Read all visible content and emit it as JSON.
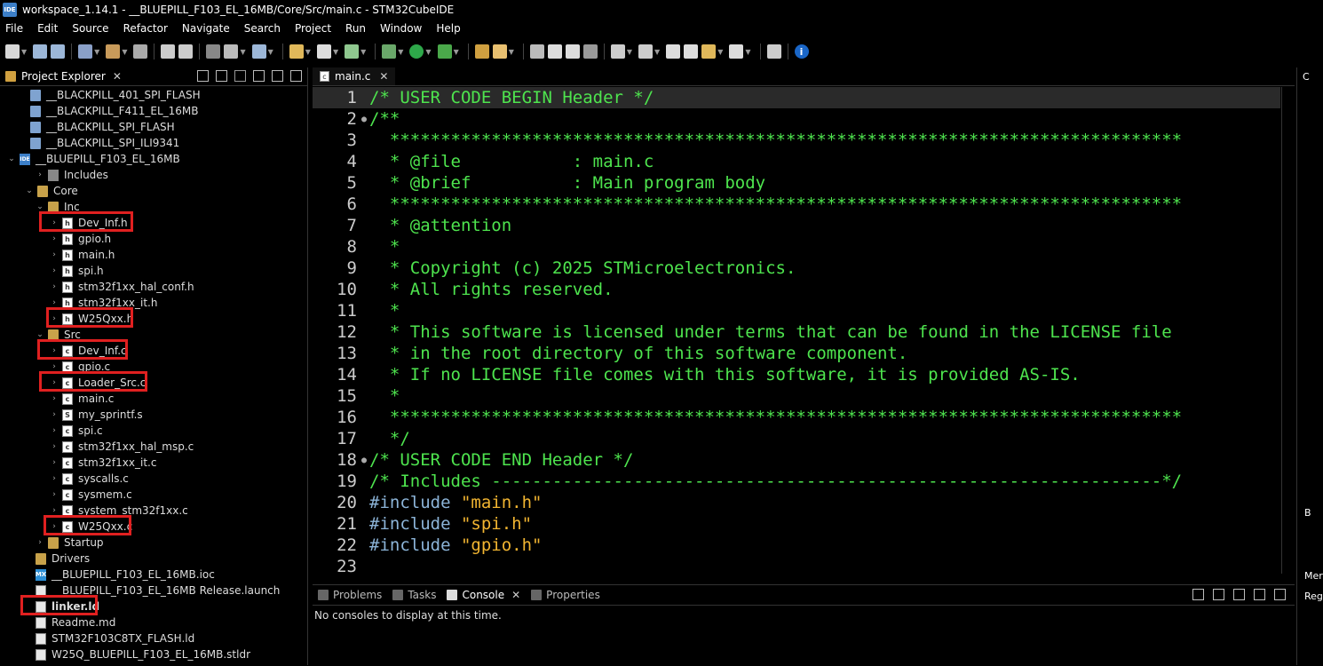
{
  "window": {
    "title": "workspace_1.14.1 - __BLUEPILL_F103_EL_16MB/Core/Src/main.c - STM32CubeIDE",
    "app_icon": "IDE"
  },
  "menu": [
    "File",
    "Edit",
    "Source",
    "Refactor",
    "Navigate",
    "Search",
    "Project",
    "Run",
    "Window",
    "Help"
  ],
  "explorer": {
    "tab_label": "Project Explorer",
    "items": [
      {
        "label": "__BLACKPILL_401_SPI_FLASH",
        "icon": "project-folder-icon"
      },
      {
        "label": "__BLACKPILL_F411_EL_16MB",
        "icon": "project-folder-icon"
      },
      {
        "label": "__BLACKPILL_SPI_FLASH",
        "icon": "project-folder-icon"
      },
      {
        "label": "__BLACKPILL_SPI_ILI9341",
        "icon": "project-folder-icon"
      },
      {
        "label": "__BLUEPILL_F103_EL_16MB",
        "icon": "ide-project-icon"
      },
      {
        "label": "Includes",
        "icon": "includes-icon"
      },
      {
        "label": "Core",
        "icon": "folder-icon"
      },
      {
        "label": "Inc",
        "icon": "folder-icon"
      },
      {
        "label": "Dev_Inf.h",
        "icon": "h-file-icon"
      },
      {
        "label": "gpio.h",
        "icon": "h-file-icon"
      },
      {
        "label": "main.h",
        "icon": "h-file-icon"
      },
      {
        "label": "spi.h",
        "icon": "h-file-icon"
      },
      {
        "label": "stm32f1xx_hal_conf.h",
        "icon": "h-file-icon"
      },
      {
        "label": "stm32f1xx_it.h",
        "icon": "h-file-icon"
      },
      {
        "label": "W25Qxx.h",
        "icon": "h-file-icon"
      },
      {
        "label": "Src",
        "icon": "folder-icon"
      },
      {
        "label": "Dev_Inf.c",
        "icon": "c-file-icon"
      },
      {
        "label": "gpio.c",
        "icon": "c-file-icon"
      },
      {
        "label": "Loader_Src.c",
        "icon": "c-file-icon"
      },
      {
        "label": "main.c",
        "icon": "c-file-icon"
      },
      {
        "label": "my_sprintf.s",
        "icon": "s-file-icon"
      },
      {
        "label": "spi.c",
        "icon": "c-file-icon"
      },
      {
        "label": "stm32f1xx_hal_msp.c",
        "icon": "c-file-icon"
      },
      {
        "label": "stm32f1xx_it.c",
        "icon": "c-file-icon"
      },
      {
        "label": "syscalls.c",
        "icon": "c-file-icon"
      },
      {
        "label": "sysmem.c",
        "icon": "c-file-icon"
      },
      {
        "label": "system_stm32f1xx.c",
        "icon": "c-file-icon"
      },
      {
        "label": "W25Qxx.c",
        "icon": "c-file-icon"
      },
      {
        "label": "Startup",
        "icon": "folder-icon"
      },
      {
        "label": "Drivers",
        "icon": "folder-icon"
      },
      {
        "label": "__BLUEPILL_F103_EL_16MB.ioc",
        "icon": "mx-file-icon"
      },
      {
        "label": "__BLUEPILL_F103_EL_16MB Release.launch",
        "icon": "launch-file-icon"
      },
      {
        "label": "linker.ld",
        "icon": "ld-file-icon"
      },
      {
        "label": "Readme.md",
        "icon": "doc-file-icon"
      },
      {
        "label": "STM32F103C8TX_FLASH.ld",
        "icon": "ld-file-icon"
      },
      {
        "label": "W25Q_BLUEPILL_F103_EL_16MB.stldr",
        "icon": "doc-file-icon"
      }
    ]
  },
  "editor": {
    "tab_label": "main.c",
    "lines": [
      {
        "n": "1",
        "parts": [
          {
            "t": "/* USER CODE BEGIN Header */",
            "c": "txt"
          }
        ]
      },
      {
        "n": "2",
        "fold": true,
        "parts": [
          {
            "t": "/**",
            "c": "txt"
          }
        ]
      },
      {
        "n": "3",
        "parts": [
          {
            "t": "  ******************************************************************************",
            "c": "txt"
          }
        ]
      },
      {
        "n": "4",
        "parts": [
          {
            "t": "  * @file           : main.c",
            "c": "txt"
          }
        ]
      },
      {
        "n": "5",
        "parts": [
          {
            "t": "  * @brief          : Main program body",
            "c": "txt"
          }
        ]
      },
      {
        "n": "6",
        "parts": [
          {
            "t": "  ******************************************************************************",
            "c": "txt"
          }
        ]
      },
      {
        "n": "7",
        "parts": [
          {
            "t": "  * @attention",
            "c": "txt"
          }
        ]
      },
      {
        "n": "8",
        "parts": [
          {
            "t": "  *",
            "c": "txt"
          }
        ]
      },
      {
        "n": "9",
        "parts": [
          {
            "t": "  * Copyright (c) 2025 STMicroelectronics.",
            "c": "txt"
          }
        ]
      },
      {
        "n": "10",
        "parts": [
          {
            "t": "  * All rights reserved.",
            "c": "txt"
          }
        ]
      },
      {
        "n": "11",
        "parts": [
          {
            "t": "  *",
            "c": "txt"
          }
        ]
      },
      {
        "n": "12",
        "parts": [
          {
            "t": "  * This software is licensed under terms that can be found in the LICENSE file",
            "c": "txt"
          }
        ]
      },
      {
        "n": "13",
        "parts": [
          {
            "t": "  * in the root directory of this software component.",
            "c": "txt"
          }
        ]
      },
      {
        "n": "14",
        "parts": [
          {
            "t": "  * If no LICENSE file comes with this software, it is provided AS-IS.",
            "c": "txt"
          }
        ]
      },
      {
        "n": "15",
        "parts": [
          {
            "t": "  *",
            "c": "txt"
          }
        ]
      },
      {
        "n": "16",
        "parts": [
          {
            "t": "  ******************************************************************************",
            "c": "txt"
          }
        ]
      },
      {
        "n": "17",
        "parts": [
          {
            "t": "  */",
            "c": "txt"
          }
        ]
      },
      {
        "n": "18",
        "fold": true,
        "parts": [
          {
            "t": "/* USER CODE END Header */",
            "c": "txt"
          }
        ]
      },
      {
        "n": "19",
        "parts": [
          {
            "t": "/* Includes ------------------------------------------------------------------*/",
            "c": "txt"
          }
        ]
      },
      {
        "n": "20",
        "parts": [
          {
            "t": "#include ",
            "c": "kw"
          },
          {
            "t": "\"main.h\"",
            "c": "str"
          }
        ]
      },
      {
        "n": "21",
        "parts": [
          {
            "t": "#include ",
            "c": "kw"
          },
          {
            "t": "\"spi.h\"",
            "c": "str"
          }
        ]
      },
      {
        "n": "22",
        "parts": [
          {
            "t": "#include ",
            "c": "kw"
          },
          {
            "t": "\"gpio.h\"",
            "c": "str"
          }
        ]
      },
      {
        "n": "23",
        "parts": []
      }
    ]
  },
  "console": {
    "tabs": [
      {
        "label": "Problems",
        "active": false
      },
      {
        "label": "Tasks",
        "active": false
      },
      {
        "label": "Console",
        "active": true
      },
      {
        "label": "Properties",
        "active": false
      }
    ],
    "message": "No consoles to display at this time."
  },
  "right_strip": {
    "label_top": "C",
    "label_mid": "B",
    "label_mem": "Mer",
    "label_reg": "Reg"
  }
}
